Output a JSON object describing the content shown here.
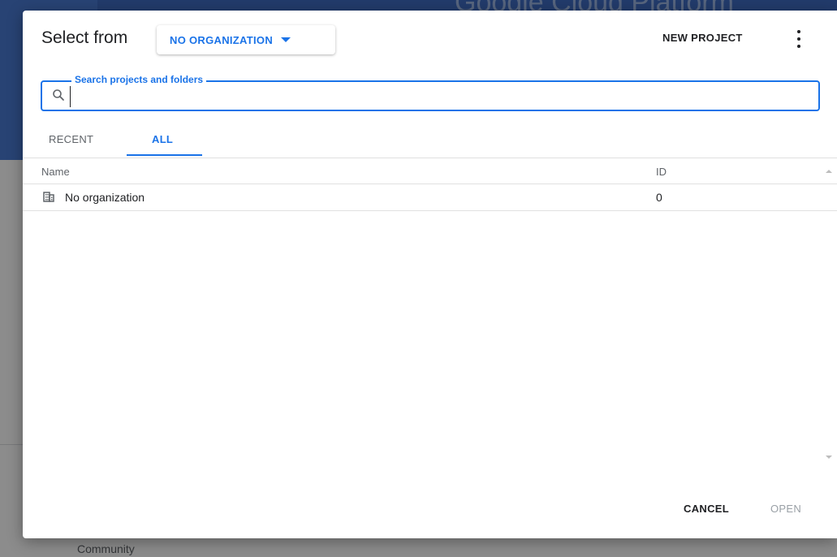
{
  "background": {
    "title": "Google Cloud Platform",
    "community_label": "Community"
  },
  "dialog": {
    "title": "Select from",
    "org_select": {
      "value": "NO ORGANIZATION"
    },
    "new_project_label": "NEW PROJECT",
    "search": {
      "label": "Search projects and folders",
      "value": ""
    },
    "tabs": [
      {
        "label": "RECENT",
        "active": false
      },
      {
        "label": "ALL",
        "active": true
      }
    ],
    "table": {
      "columns": [
        "Name",
        "ID"
      ],
      "rows": [
        {
          "icon": "building-icon",
          "name": "No organization",
          "id": "0"
        }
      ]
    },
    "buttons": {
      "cancel": "CANCEL",
      "open": "OPEN"
    }
  },
  "colors": {
    "accent": "#1a73e8",
    "header_bg": "#3f6cc4"
  }
}
